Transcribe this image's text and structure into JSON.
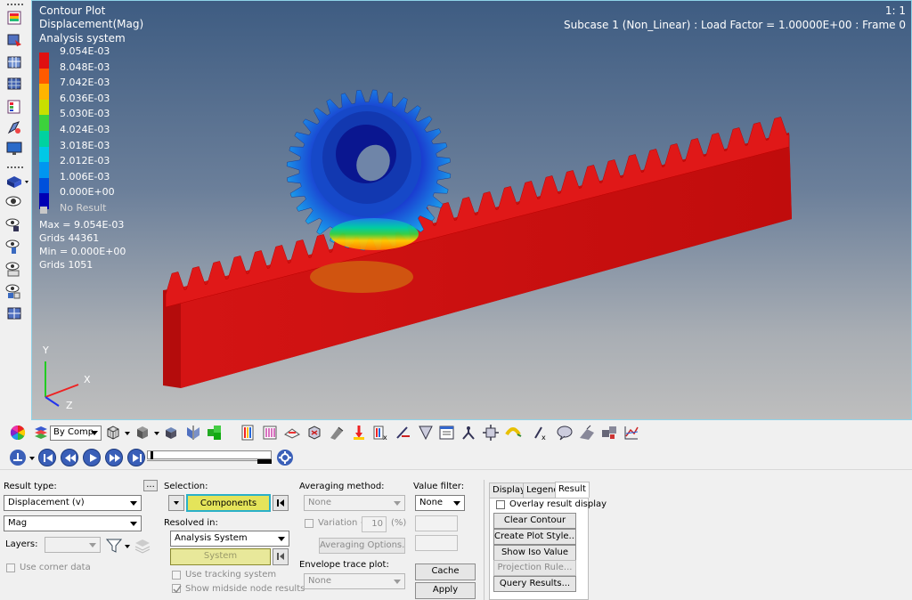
{
  "viewport": {
    "title_lines": [
      "Contour Plot",
      "Displacement(Mag)",
      "Analysis system"
    ],
    "scale": "1: 1",
    "subcase": "Subcase 1 (Non_Linear) : Load Factor =  1.00000E+00 : Frame 0",
    "legend": [
      {
        "value": "9.054E-03",
        "color": "#e01010"
      },
      {
        "value": "8.048E-03",
        "color": "#ff5a00"
      },
      {
        "value": "7.042E-03",
        "color": "#ffb400"
      },
      {
        "value": "6.036E-03",
        "color": "#c8e000"
      },
      {
        "value": "5.030E-03",
        "color": "#3cd23c"
      },
      {
        "value": "4.024E-03",
        "color": "#00d2a0"
      },
      {
        "value": "3.018E-03",
        "color": "#00c8e6"
      },
      {
        "value": "2.012E-03",
        "color": "#0096f0"
      },
      {
        "value": "1.006E-03",
        "color": "#0050dc"
      },
      {
        "value": "0.000E+00",
        "color": "#0000b4"
      }
    ],
    "no_result": "No Result",
    "stats": [
      "Max =  9.054E-03",
      "Grids 44361",
      "Min =  0.000E+00",
      "Grids 1051"
    ],
    "axes": {
      "x": "X",
      "y": "Y",
      "z": "Z"
    }
  },
  "toolbar": {
    "by_comp": "By Comp",
    "icons": [
      "color-wheel-icon",
      "layers-icon",
      "by-comp-dropdown",
      "wireframe-cube-icon",
      "shaded-cube-icon",
      "component-icon",
      "mirror-icon",
      "visualization-icon",
      "contour-icon",
      "iso-icon",
      "deformed-icon",
      "tensor-icon",
      "marker-icon",
      "vector-icon",
      "flexbody-icon",
      "measure-icon",
      "note-icon",
      "axis-icon",
      "tracking-icon",
      "curve-icon",
      "probe-icon",
      "callout-icon",
      "section-icon",
      "exploded-icon",
      "plot-icon"
    ]
  },
  "panel": {
    "result_type": {
      "label": "Result type:",
      "more": "...",
      "value": "Displacement (v)",
      "component": "Mag",
      "layers_label": "Layers:",
      "use_corner_data": "Use corner data"
    },
    "selection": {
      "label": "Selection:",
      "button": "Components",
      "resolved_label": "Resolved in:",
      "resolved_value": "Analysis System",
      "system_button": "System",
      "use_tracking": "Use tracking system",
      "show_midside": "Show midside node results"
    },
    "averaging": {
      "label": "Averaging method:",
      "value": "None",
      "variation_label": "Variation <",
      "variation_value": "10",
      "variation_unit": "(%)",
      "options_button": "Averaging Options...",
      "envelope_label": "Envelope trace plot:",
      "envelope_value": "None"
    },
    "value_filter": {
      "label": "Value filter:",
      "value": "None",
      "cache": "Cache",
      "apply": "Apply"
    },
    "tabs": {
      "items": [
        "Display",
        "Legend",
        "Result"
      ],
      "active": "Result",
      "overlay": "Overlay result display",
      "clear_contour": "Clear Contour",
      "create_plot_style": "Create Plot Style...",
      "show_iso_value": "Show Iso Value",
      "projection_rule": "Projection Rule...",
      "query_results": "Query Results..."
    }
  }
}
